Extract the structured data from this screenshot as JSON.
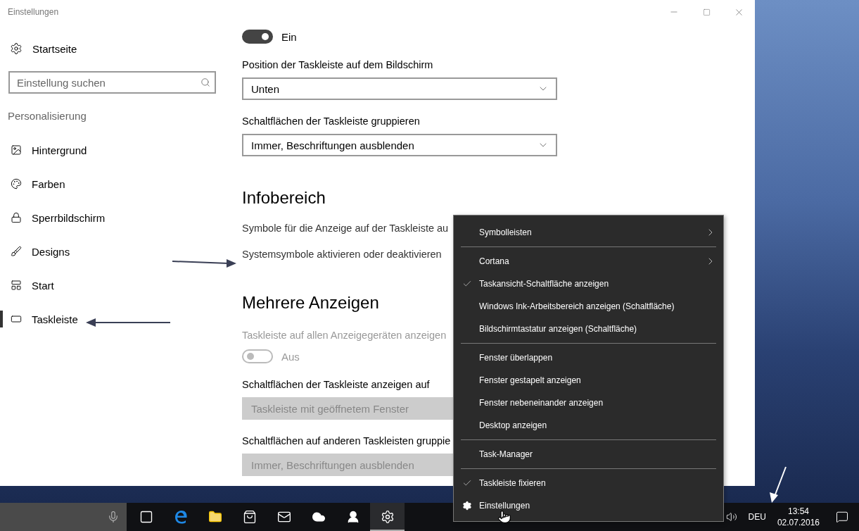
{
  "window": {
    "title": "Einstellungen"
  },
  "sidebar": {
    "home": "Startseite",
    "search_placeholder": "Einstellung suchen",
    "section": "Personalisierung",
    "items": [
      {
        "kind": "background",
        "label": "Hintergrund",
        "selected": false
      },
      {
        "kind": "colors",
        "label": "Farben",
        "selected": false
      },
      {
        "kind": "lockscreen",
        "label": "Sperrbildschirm",
        "selected": false
      },
      {
        "kind": "themes",
        "label": "Designs",
        "selected": false
      },
      {
        "kind": "start",
        "label": "Start",
        "selected": false
      },
      {
        "kind": "taskbar",
        "label": "Taskleiste",
        "selected": true
      }
    ]
  },
  "content": [
    {
      "kind": "toggle",
      "on": true,
      "disabled": false,
      "label": "Ein"
    },
    {
      "kind": "label",
      "text": "Position der Taskleiste auf dem Bildschirm",
      "disabled": false
    },
    {
      "kind": "dropdown",
      "value": "Unten",
      "disabled": false
    },
    {
      "kind": "label",
      "text": "Schaltflächen der Taskleiste gruppieren",
      "disabled": false
    },
    {
      "kind": "dropdown",
      "value": "Immer, Beschriftungen ausblenden",
      "disabled": false
    },
    {
      "kind": "heading",
      "text": "Infobereich"
    },
    {
      "kind": "link",
      "text": "Symbole für die Anzeige auf der Taskleiste au"
    },
    {
      "kind": "link",
      "text": "Systemsymbole aktivieren oder deaktivieren"
    },
    {
      "kind": "heading",
      "text": "Mehrere Anzeigen"
    },
    {
      "kind": "label",
      "text": "Taskleiste auf allen Anzeigegeräten anzeigen",
      "disabled": true
    },
    {
      "kind": "toggle",
      "on": false,
      "disabled": true,
      "label": "Aus"
    },
    {
      "kind": "label",
      "text": "Schaltflächen der Taskleiste anzeigen auf",
      "disabled": false
    },
    {
      "kind": "dropdown",
      "value": "Taskleiste mit geöffnetem Fenster",
      "disabled": true
    },
    {
      "kind": "label",
      "text": "Schaltflächen auf anderen Taskleisten gruppie",
      "disabled": false
    },
    {
      "kind": "dropdown",
      "value": "Immer, Beschriftungen ausblenden",
      "disabled": true
    }
  ],
  "context_menu": [
    {
      "kind": "item",
      "label": "Symbolleisten",
      "checked": false,
      "submenu": true
    },
    {
      "kind": "separator"
    },
    {
      "kind": "item",
      "label": "Cortana",
      "checked": false,
      "submenu": true
    },
    {
      "kind": "item",
      "label": "Taskansicht-Schaltfläche anzeigen",
      "checked": true,
      "submenu": false
    },
    {
      "kind": "item",
      "label": "Windows Ink-Arbeitsbereich anzeigen (Schaltfläche)",
      "checked": false,
      "submenu": false
    },
    {
      "kind": "item",
      "label": "Bildschirmtastatur anzeigen (Schaltfläche)",
      "checked": false,
      "submenu": false
    },
    {
      "kind": "separator"
    },
    {
      "kind": "item",
      "label": "Fenster überlappen",
      "checked": false,
      "submenu": false
    },
    {
      "kind": "item",
      "label": "Fenster gestapelt anzeigen",
      "checked": false,
      "submenu": false
    },
    {
      "kind": "item",
      "label": "Fenster nebeneinander anzeigen",
      "checked": false,
      "submenu": false
    },
    {
      "kind": "item",
      "label": "Desktop anzeigen",
      "checked": false,
      "submenu": false
    },
    {
      "kind": "separator"
    },
    {
      "kind": "item",
      "label": "Task-Manager",
      "checked": false,
      "submenu": false
    },
    {
      "kind": "separator"
    },
    {
      "kind": "item",
      "label": "Taskleiste fixieren",
      "checked": true,
      "submenu": false
    },
    {
      "kind": "settings",
      "label": "Einstellungen",
      "submenu": false
    }
  ],
  "taskbar": {
    "apps": [
      {
        "kind": "taskview",
        "selected": false
      },
      {
        "kind": "edge",
        "selected": false
      },
      {
        "kind": "explorer",
        "selected": false
      },
      {
        "kind": "store",
        "selected": false
      },
      {
        "kind": "mail",
        "selected": false
      },
      {
        "kind": "onedrive",
        "selected": false
      },
      {
        "kind": "people",
        "selected": false
      },
      {
        "kind": "settings",
        "selected": true
      }
    ],
    "language": "DEU",
    "time": "13:54",
    "date": "02.07.2016"
  }
}
